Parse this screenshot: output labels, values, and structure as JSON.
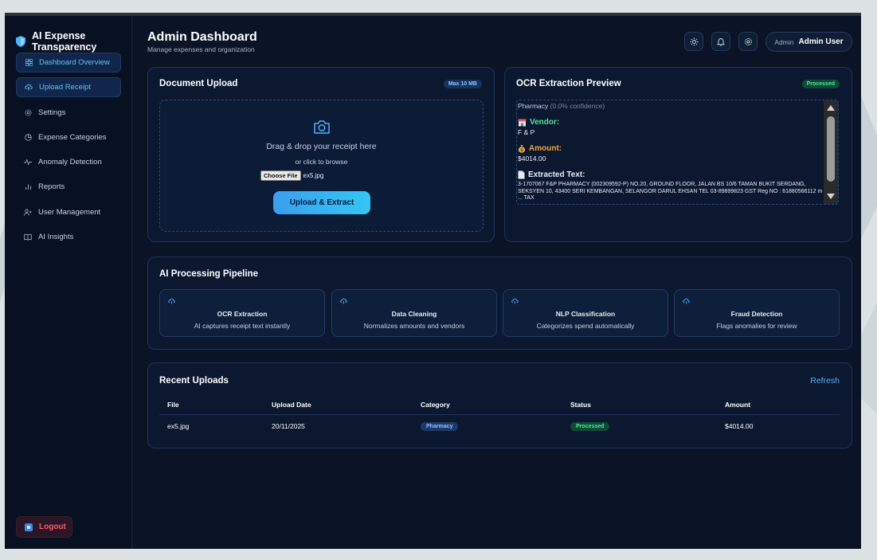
{
  "brand": {
    "name": "AI Expense Transparency"
  },
  "sidebar": {
    "items": [
      {
        "label": "Dashboard Overview",
        "icon": "grid-icon",
        "active": true
      },
      {
        "label": "Upload Receipt",
        "icon": "upload-cloud-icon",
        "active": true
      },
      {
        "label": "Settings",
        "icon": "gear-icon",
        "active": false
      },
      {
        "label": "Expense Categories",
        "icon": "pie-icon",
        "active": false
      },
      {
        "label": "Anomaly Detection",
        "icon": "pulse-icon",
        "active": false
      },
      {
        "label": "Reports",
        "icon": "bar-chart-icon",
        "active": false
      },
      {
        "label": "User Management",
        "icon": "users-icon",
        "active": false
      },
      {
        "label": "AI Insights",
        "icon": "book-icon",
        "active": false
      }
    ],
    "logout_label": "Logout"
  },
  "header": {
    "title": "Admin Dashboard",
    "subtitle": "Manage expenses and organization",
    "user_role": "Admin",
    "user_name": "Admin User"
  },
  "upload": {
    "title": "Document Upload",
    "badge": "Max 10 MB",
    "drop_text": "Drag & drop your receipt here",
    "or_text": "or click to browse",
    "choose_label": "Choose File",
    "file_name": "ex5.jpg",
    "button": "Upload & Extract"
  },
  "ocr": {
    "title": "OCR Extraction Preview",
    "badge": "Processed",
    "category": "Pharmacy",
    "confidence": "(0.0% confidence)",
    "vendor_label": "Vendor:",
    "vendor_value": "F & P",
    "amount_label": "Amount:",
    "amount_value": "$4014.00",
    "text_label": "Extracted Text:",
    "raw_text": "3-1707067 F&P PHARMACY (002309592-P) NO.20, GROUND FLOOR, JALAN BS 10/6 TAMAN BUKIT SERDANG, SEKSYEN 10, 43400 SERI KEMBANGAN, SELANGOR DARUL EHSAN TEL 03-89899823 GST Reg NO : 61880566112 m ... TAX"
  },
  "pipeline": {
    "title": "AI Processing Pipeline",
    "steps": [
      {
        "title": "OCR Extraction",
        "desc": "AI captures receipt text instantly"
      },
      {
        "title": "Data Cleaning",
        "desc": "Normalizes amounts and vendors"
      },
      {
        "title": "NLP Classification",
        "desc": "Categorizes spend automatically"
      },
      {
        "title": "Fraud Detection",
        "desc": "Flags anomalies for review"
      }
    ]
  },
  "recent": {
    "title": "Recent Uploads",
    "refresh": "Refresh",
    "columns": [
      "File",
      "Upload Date",
      "Category",
      "Status",
      "Amount"
    ],
    "rows": [
      {
        "file": "ex5.jpg",
        "date": "20/11/2025",
        "category": "Pharmacy",
        "status": "Processed",
        "amount": "$4014.00"
      }
    ]
  },
  "colors": {
    "accent": "#4fb3ff",
    "success": "#4de39a",
    "warning": "#f0a63a",
    "danger": "#ff5a6e",
    "panel": "#0b1830"
  }
}
